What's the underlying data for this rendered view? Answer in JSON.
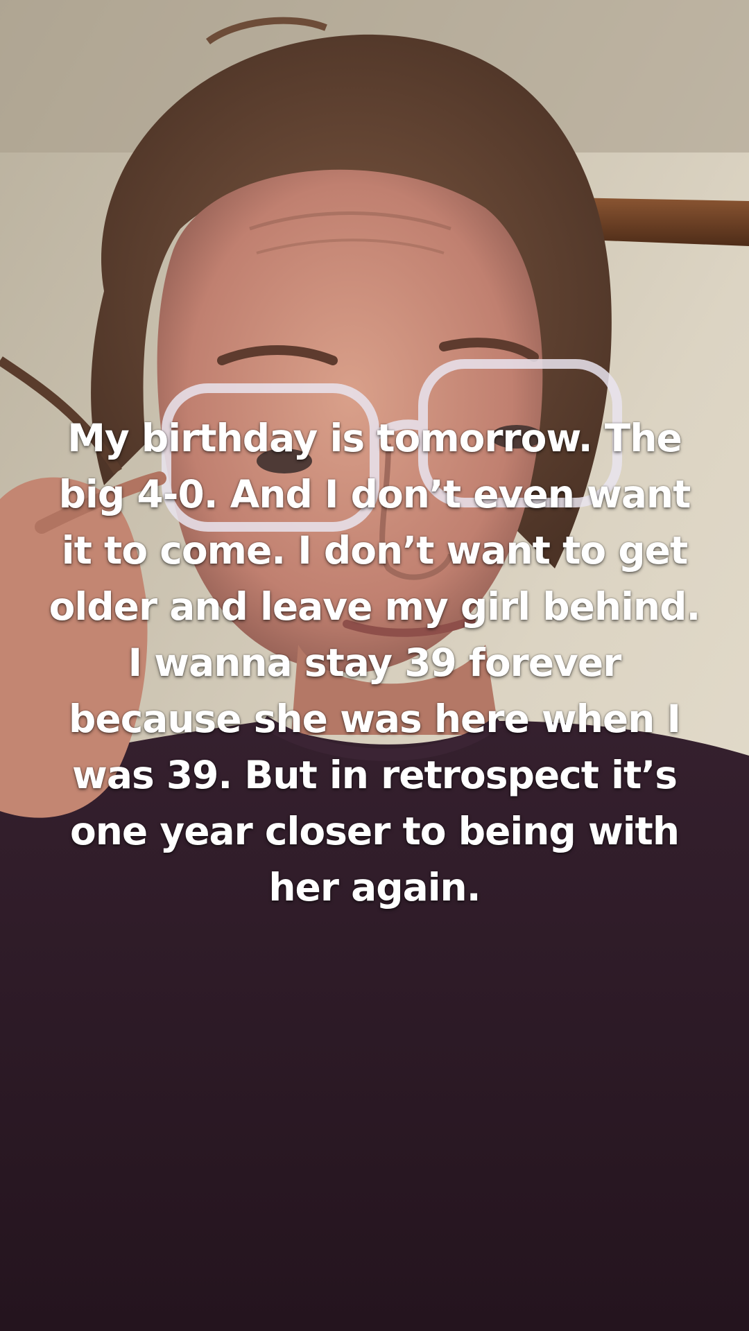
{
  "caption": {
    "lines": [
      "My birthday is tomorrow. The",
      "big 4-0. And I don’t even want",
      "it to come. I don’t want to get",
      "older and leave my girl behind.",
      "I wanna stay 39 forever",
      "because she was here when I",
      "was 39. But in retrospect it’s",
      "one year closer to being with",
      "her again."
    ]
  },
  "colors": {
    "caption_text": "#ffffff",
    "wall": "#d8cfbe",
    "shirt": "#2c1a27",
    "hair": "#6b4a35",
    "skin": "#c98e7a",
    "trim": "#6a3f25"
  }
}
